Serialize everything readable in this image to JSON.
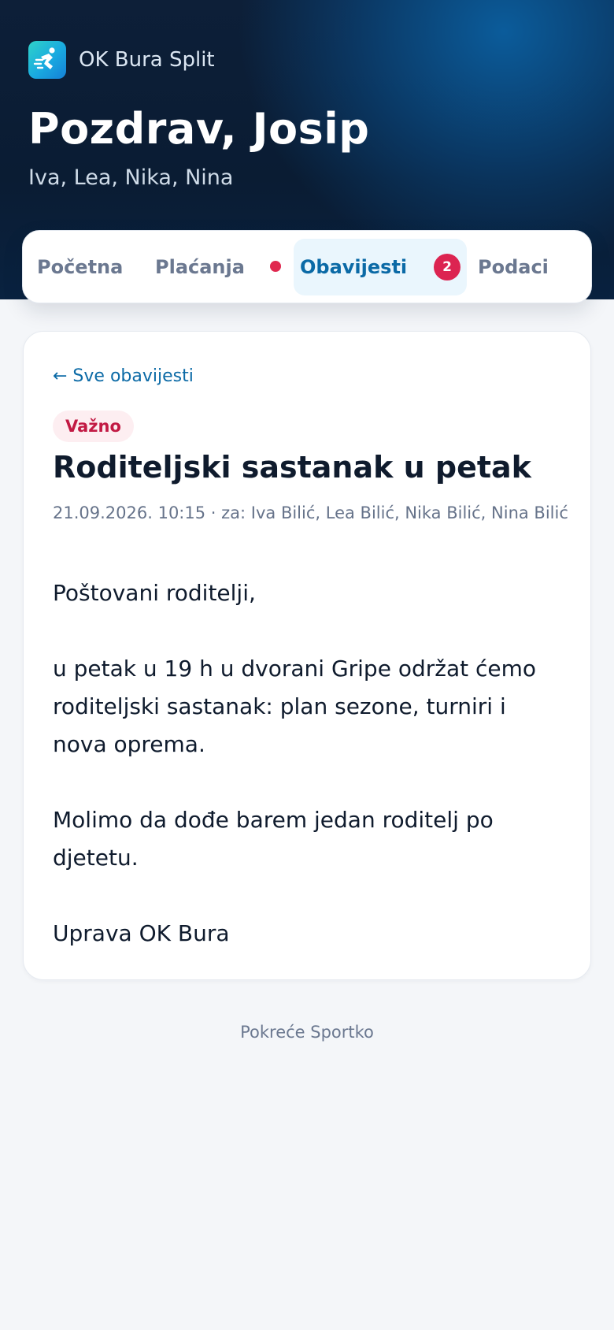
{
  "app": {
    "club_name": "OK Bura Split",
    "logo_icon": "runner-icon",
    "accent": "#0b6aa6",
    "alert": "#dc2451"
  },
  "header": {
    "greeting": "Pozdrav, Josip",
    "children": "Iva, Lea, Nika, Nina"
  },
  "tabs": [
    {
      "label": "Početna",
      "active": false
    },
    {
      "label": "Plaćanja",
      "active": false,
      "indicator": "dot"
    },
    {
      "label": "Obavijesti",
      "active": true,
      "badge": "2"
    },
    {
      "label": "Podaci",
      "active": false
    }
  ],
  "notice": {
    "back_link": "← Sve obavijesti",
    "tag": "Važno",
    "title": "Roditeljski sastanak u petak",
    "meta": "21.09.2026. 10:15 · za: Iva Bilić, Lea Bilić, Nika Bilić, Nina Bilić",
    "paragraphs": [
      "Poštovani roditelji,",
      "u petak u 19 h u dvorani Gripe održat ćemo roditeljski sastanak: plan sezone, turniri i nova oprema.",
      "Molimo da dođe barem jedan roditelj po djetetu.",
      "Uprava OK Bura"
    ]
  },
  "footer": {
    "powered_by": "Pokreće Sportko"
  }
}
